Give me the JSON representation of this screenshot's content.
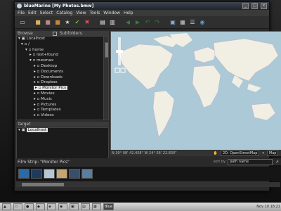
{
  "window": {
    "title": "blueMarine [My Photos.bmw]"
  },
  "menu": [
    "File",
    "Edit",
    "Select",
    "Catalog",
    "View",
    "Tools",
    "Window",
    "Help"
  ],
  "toolbar": {
    "icons": [
      "screen-icon",
      "folder-icon",
      "image-icon",
      "box-icon",
      "star-icon",
      "check-icon",
      "reject-icon",
      "page-icon",
      "page-icon",
      "back-icon",
      "forward-icon",
      "undo-icon",
      "redo-icon",
      "monitor-icon",
      "grid-icon",
      "list-icon",
      "globe-icon"
    ]
  },
  "browse": {
    "header": "Browse",
    "subfolders_label": "Subfolders",
    "tree": [
      {
        "label": "Localhost"
      },
      {
        "label": "/"
      },
      {
        "label": "home"
      },
      {
        "label": "lost+found"
      },
      {
        "label": "mesmax"
      },
      {
        "label": "Desktop"
      },
      {
        "label": "Documents"
      },
      {
        "label": "Downloads"
      },
      {
        "label": "Dropbox"
      },
      {
        "label": "Monitor Pics"
      },
      {
        "label": "Movies"
      },
      {
        "label": "Music"
      },
      {
        "label": "Pictures"
      },
      {
        "label": "Templates"
      },
      {
        "label": "Videos"
      }
    ]
  },
  "target": {
    "header": "Target",
    "items": [
      "Localhost"
    ]
  },
  "map": {
    "coords": "N 30° 08' 42.458\" W 24° 56' 22.830\"",
    "provider": "2D: OpenStreetMap",
    "view_mode": "Map"
  },
  "filmstrip": {
    "header": "Film Strip: \"Monitor Pics\"",
    "sort_label": "sort by",
    "sort_value": "path name",
    "thumbs": [
      "#2b6aa8",
      "#1e3b5e",
      "#b7c6d2",
      "#c4a670",
      "#3a4e6a",
      "#5b7da0"
    ]
  },
  "taskbar": {
    "buttons": [
      "",
      "",
      "",
      "",
      "",
      "",
      "",
      "",
      "",
      "Blue"
    ],
    "clock": "Nov 10 18:21"
  }
}
